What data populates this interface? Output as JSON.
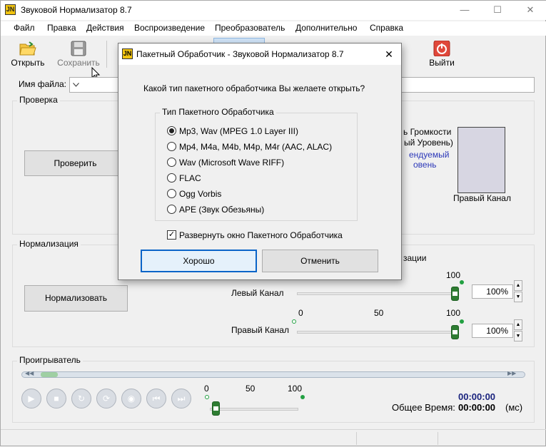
{
  "window": {
    "title": "Звуковой Нормализатор 8.7",
    "icon": "JN"
  },
  "menu": [
    "Файл",
    "Правка",
    "Действия",
    "Воспроизведение",
    "Преобразователь",
    "Дополнительно",
    "Справка"
  ],
  "toolbar": {
    "open": "Открыть",
    "save": "Сохранить",
    "exit": "Выйти"
  },
  "filename_label": "Имя файла:",
  "check": {
    "group": "Проверка",
    "button": "Проверить",
    "volume_fragment_1": "ь Громкости",
    "volume_fragment_2": "ый Уровень)",
    "recommended_1": "ендуемый",
    "recommended_2": "овень",
    "right_channel": "Правый Канал"
  },
  "normalize": {
    "group": "Нормализация",
    "button": "Нормализовать",
    "header_fragment": "зации",
    "left_channel": "Левый Канал",
    "right_channel": "Правый Канал",
    "left_value": "100%",
    "right_value": "100%",
    "left_level": 100,
    "right_level": 100,
    "scale": [
      "0",
      "50",
      "100"
    ],
    "scale_top": "100"
  },
  "player": {
    "group": "Проигрыватель",
    "scale": [
      "0",
      "50",
      "100"
    ],
    "current_time": "00:00:00",
    "total_label": "Общее Время:",
    "total_time": "00:00:00",
    "unit": "(мс)"
  },
  "dialog": {
    "title": "Пакетный Обработчик - Звуковой Нормализатор 8.7",
    "question": "Какой тип пакетного обработчика Вы желаете открыть?",
    "group": "Тип Пакетного Обработчика",
    "options": [
      "Mp3, Wav (MPEG 1.0 Layer III)",
      "Mp4, M4a, M4b, M4p, M4r (AAC, ALAC)",
      "Wav (Microsoft Wave RIFF)",
      "FLAC",
      "Ogg Vorbis",
      "APE (Звук Обезьяны)"
    ],
    "selected_index": 0,
    "expand_label": "Развернуть окно Пакетного Обработчика",
    "expand_checked": true,
    "ok": "Хорошо",
    "cancel": "Отменить"
  },
  "colors": {
    "accent_blue": "#1a237e",
    "thumb_green": "#2e7d32",
    "dialog_border": "#777777"
  }
}
